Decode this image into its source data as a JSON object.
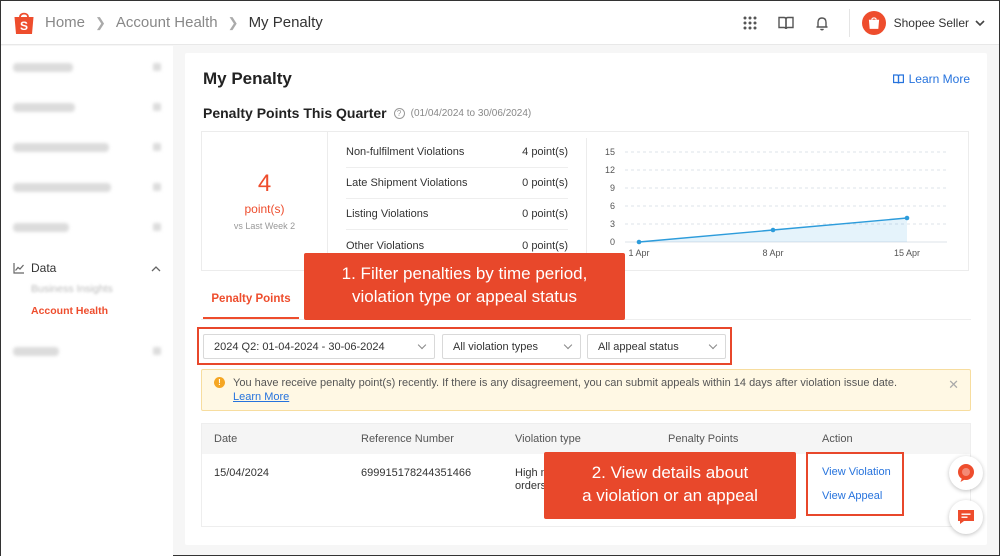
{
  "breadcrumb": {
    "home": "Home",
    "account_health": "Account Health",
    "current": "My Penalty"
  },
  "user": {
    "name": "Shopee Seller"
  },
  "sidebar": {
    "data_label": "Data",
    "sub_items": [
      "Business Insights",
      "Account Health"
    ]
  },
  "page": {
    "title": "My Penalty",
    "learn_more": "Learn More",
    "section_title": "Penalty Points This Quarter",
    "date_range": "(01/04/2024 to 30/06/2024)"
  },
  "summary": {
    "total": "4",
    "unit": "point(s)",
    "comparison": "vs Last Week 2",
    "violations": [
      {
        "name": "Non-fulfilment Violations",
        "points": "4 point(s)"
      },
      {
        "name": "Late Shipment Violations",
        "points": "0 point(s)"
      },
      {
        "name": "Listing Violations",
        "points": "0 point(s)"
      },
      {
        "name": "Other Violations",
        "points": "0 point(s)"
      }
    ]
  },
  "chart_data": {
    "type": "area",
    "x": [
      "1 Apr",
      "8 Apr",
      "15 Apr"
    ],
    "y": [
      0,
      2,
      4
    ],
    "yticks": [
      0,
      3,
      6,
      9,
      12,
      15
    ],
    "ylim": [
      0,
      15
    ],
    "grid": true,
    "color": "#2d9cdb"
  },
  "tabs": [
    {
      "label": "Penalty Points"
    }
  ],
  "filters": {
    "period": "2024 Q2: 01-04-2024 - 30-06-2024",
    "violation_type": "All violation types",
    "appeal_status": "All appeal status"
  },
  "alert": {
    "text": "You have receive penalty point(s) recently. If there is any disagreement, you can submit appeals within 14 days after violation issue date.",
    "link": "Learn More"
  },
  "table": {
    "headers": [
      "Date",
      "Reference Number",
      "Violation type",
      "Penalty Points",
      "Action"
    ],
    "rows": [
      {
        "date": "15/04/2024",
        "ref": "699915178244351466",
        "type": "High n",
        "type2": "orders",
        "actions": [
          "View Violation",
          "View Appeal"
        ]
      }
    ]
  },
  "callouts": {
    "first_line1": "1. Filter penalties by time period,",
    "first_line2": "violation type or appeal status",
    "second_line1": "2. View details about",
    "second_line2": "a violation or an appeal"
  },
  "colors": {
    "brand": "#ee4d2d",
    "link": "#2673dd",
    "callout": "#e8482b"
  }
}
